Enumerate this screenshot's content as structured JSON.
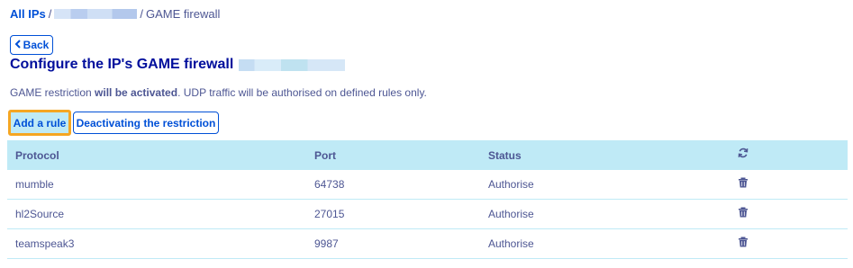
{
  "breadcrumb": {
    "root": "All IPs",
    "separator": "/",
    "current": "GAME firewall"
  },
  "back_label": "Back",
  "title": "Configure the IP's GAME firewall",
  "description": {
    "prefix": "GAME restriction ",
    "bold": "will be activated",
    "suffix": ". UDP traffic will be authorised on defined rules only."
  },
  "actions": {
    "add_rule": "Add a rule",
    "deactivate": "Deactivating the restriction"
  },
  "table": {
    "headers": {
      "protocol": "Protocol",
      "port": "Port",
      "status": "Status"
    },
    "rows": [
      {
        "protocol": "mumble",
        "port": "64738",
        "status": "Authorise"
      },
      {
        "protocol": "hl2Source",
        "port": "27015",
        "status": "Authorise"
      },
      {
        "protocol": "teamspeak3",
        "port": "9987",
        "status": "Authorise"
      }
    ]
  },
  "icons": {
    "refresh": "refresh-icon",
    "delete": "trash-icon",
    "back": "chevron-left-icon"
  },
  "colors": {
    "link": "#0050d7",
    "title": "#000e9c",
    "header_bg": "#bfeaf6",
    "highlight": "#f5a623",
    "text": "#4d5693"
  }
}
